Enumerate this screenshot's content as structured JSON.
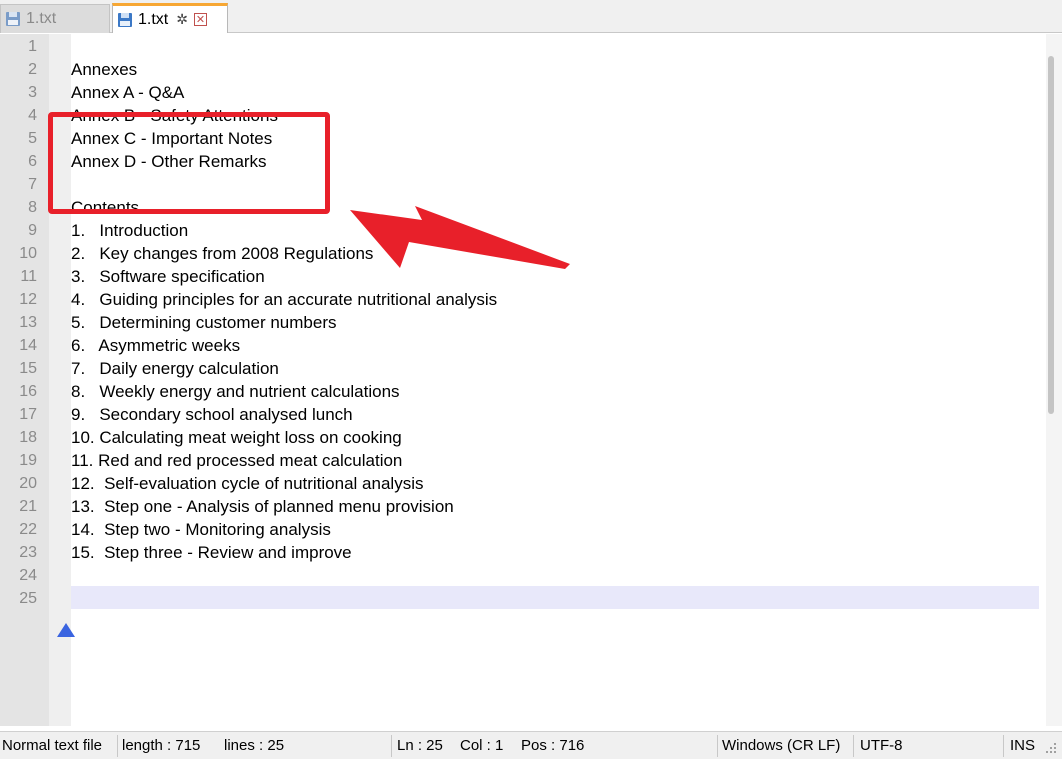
{
  "tabs": [
    {
      "label": "1.txt",
      "active": false
    },
    {
      "label": "1.txt",
      "active": true
    }
  ],
  "icons": {
    "tab_file": "floppy-disk-icon",
    "pin": "pin-icon",
    "close": "close-icon",
    "fold": "fold-triangle-icon"
  },
  "editor": {
    "lines": [
      {
        "n": "1",
        "text": ""
      },
      {
        "n": "2",
        "text": "Annexes"
      },
      {
        "n": "3",
        "text": "Annex A - Q&A"
      },
      {
        "n": "4",
        "text": "Annex B - Safety Attentions"
      },
      {
        "n": "5",
        "text": "Annex C - Important Notes"
      },
      {
        "n": "6",
        "text": "Annex D - Other Remarks"
      },
      {
        "n": "7",
        "text": ""
      },
      {
        "n": "8",
        "text": "Contents"
      },
      {
        "n": "9",
        "text": "1.   Introduction"
      },
      {
        "n": "10",
        "text": "2.   Key changes from 2008 Regulations"
      },
      {
        "n": "11",
        "text": "3.   Software specification"
      },
      {
        "n": "12",
        "text": "4.   Guiding principles for an accurate nutritional analysis"
      },
      {
        "n": "13",
        "text": "5.   Determining customer numbers"
      },
      {
        "n": "14",
        "text": "6.   Asymmetric weeks"
      },
      {
        "n": "15",
        "text": "7.   Daily energy calculation"
      },
      {
        "n": "16",
        "text": "8.   Weekly energy and nutrient calculations"
      },
      {
        "n": "17",
        "text": "9.   Secondary school analysed lunch"
      },
      {
        "n": "18",
        "text": "10. Calculating meat weight loss on cooking"
      },
      {
        "n": "19",
        "text": "11. Red and red processed meat calculation"
      },
      {
        "n": "20",
        "text": "12.  Self-evaluation cycle of nutritional analysis"
      },
      {
        "n": "21",
        "text": "13.  Step one - Analysis of planned menu provision"
      },
      {
        "n": "22",
        "text": "14.  Step two - Monitoring analysis"
      },
      {
        "n": "23",
        "text": "15.  Step three - Review and improve"
      },
      {
        "n": "24",
        "text": ""
      },
      {
        "n": "25",
        "text": ""
      }
    ]
  },
  "status": {
    "file_type": "Normal text file",
    "length": "length : 715",
    "lines": "lines : 25",
    "ln": "Ln : 25",
    "col": "Col : 1",
    "pos": "Pos : 716",
    "eol": "Windows (CR LF)",
    "encoding": "UTF-8",
    "mode": "INS"
  },
  "colors": {
    "highlight_box": "#e8202a",
    "arrow": "#e8202a",
    "active_tab_accent": "#f7a733",
    "current_line": "#e8e8fa"
  }
}
